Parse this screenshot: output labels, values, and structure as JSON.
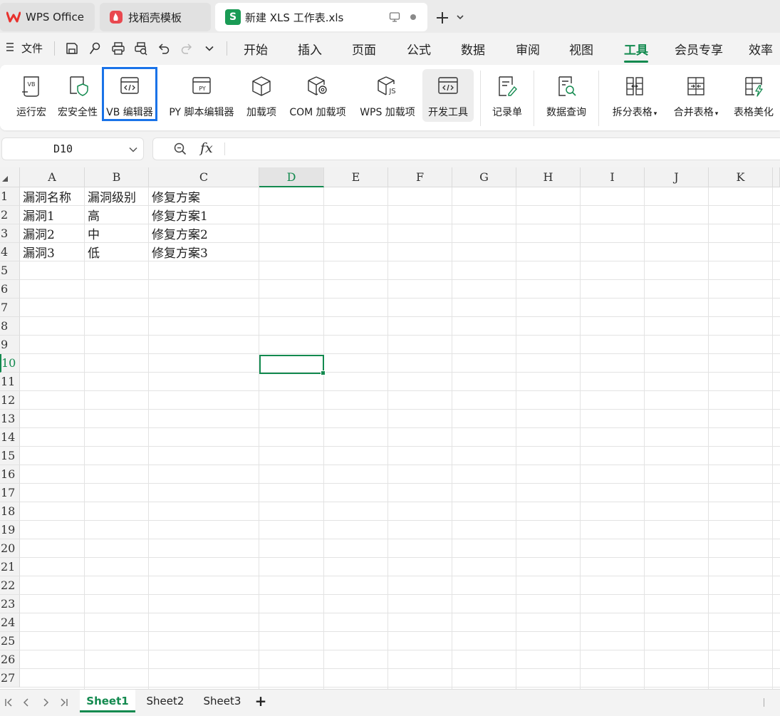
{
  "window_tabs": [
    {
      "label": "WPS Office",
      "icon": "wps-logo-icon"
    },
    {
      "label": "找稻壳模板",
      "icon": "docer-logo-icon"
    },
    {
      "label": "新建 XLS 工作表.xls",
      "icon": "sheet-s-icon",
      "icon_letter": "S"
    }
  ],
  "menu": {
    "file_label": "文件",
    "tabs": [
      "开始",
      "插入",
      "页面",
      "公式",
      "数据",
      "审阅",
      "视图",
      "工具",
      "会员专享",
      "效率"
    ],
    "active_tab": "工具"
  },
  "ribbon": {
    "buttons": [
      {
        "label": "运行宏",
        "icon": "run-macro-icon",
        "icon_text": "VB"
      },
      {
        "label": "宏安全性",
        "icon": "macro-security-icon"
      },
      {
        "label": "VB 编辑器",
        "icon": "vb-editor-icon"
      },
      {
        "label": "PY 脚本编辑器",
        "icon": "py-script-editor-icon",
        "icon_text": "PY"
      },
      {
        "label": "加载项",
        "icon": "addin-cube-icon"
      },
      {
        "label": "COM 加载项",
        "icon": "com-addin-icon"
      },
      {
        "label": "WPS 加载项",
        "icon": "wps-addin-icon",
        "icon_text": "JS"
      },
      {
        "label": "开发工具",
        "icon": "developer-tools-icon"
      },
      {
        "label": "记录单",
        "icon": "record-form-icon"
      },
      {
        "label": "数据查询",
        "icon": "data-query-icon"
      },
      {
        "label": "拆分表格",
        "icon": "split-table-icon"
      },
      {
        "label": "合并表格",
        "icon": "merge-table-icon"
      },
      {
        "label": "表格美化",
        "icon": "beautify-table-icon"
      }
    ]
  },
  "formula_bar": {
    "name_box": "D10",
    "fx_label": "fx",
    "formula": ""
  },
  "grid": {
    "columns": [
      "A",
      "B",
      "C",
      "D",
      "E",
      "F",
      "G",
      "H",
      "I",
      "J",
      "K"
    ],
    "selected_column": "D",
    "rows": [
      "1",
      "2",
      "3",
      "4",
      "5",
      "6",
      "7",
      "8",
      "9",
      "10",
      "11",
      "12",
      "13",
      "14",
      "15",
      "16",
      "17",
      "18",
      "19",
      "20",
      "21",
      "22",
      "23",
      "24",
      "25",
      "26",
      "27"
    ],
    "selected_row": "10",
    "cells": [
      [
        "漏洞名称",
        "漏洞级别",
        "修复方案"
      ],
      [
        "漏洞1",
        "高",
        "修复方案1"
      ],
      [
        "漏洞2",
        "中",
        "修复方案2"
      ],
      [
        "漏洞3",
        "低",
        "修复方案3"
      ]
    ]
  },
  "sheets": {
    "tabs": [
      "Sheet1",
      "Sheet2",
      "Sheet3"
    ],
    "active": "Sheet1",
    "add_label": "+"
  },
  "colors": {
    "accent": "#138a4f",
    "highlight": "#1a73e8",
    "wps_red": "#e8322e",
    "docer_red": "#e9484f"
  }
}
